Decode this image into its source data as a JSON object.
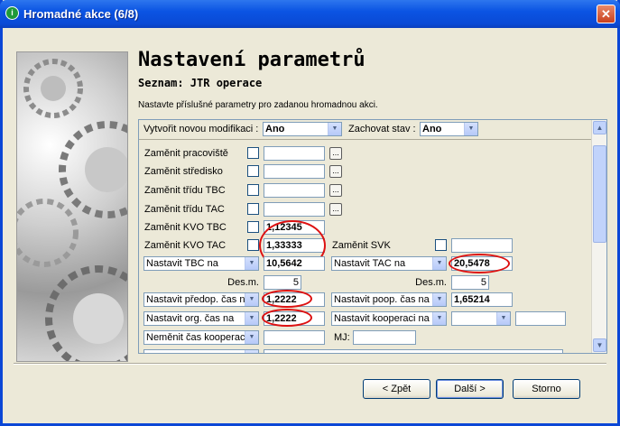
{
  "window": {
    "title": "Hromadné akce (6/8)",
    "close_glyph": "✕"
  },
  "header": {
    "title": "Nastavení parametrů",
    "subtitle": "Seznam: JTR operace",
    "description": "Nastavte příslušné parametry pro zadanou hromadnou akci."
  },
  "top_row": {
    "create_label": "Vytvořit novou modifikaci :",
    "create_value": "Ano",
    "keep_label": "Zachovat stav :",
    "keep_value": "Ano"
  },
  "rows": {
    "workplace": "Zaměnit pracoviště",
    "center": "Zaměnit středisko",
    "tbc_class": "Zaměnit třídu TBC",
    "tac_class": "Zaměnit třídu TAC",
    "kvo_tbc_label": "Zaměnit KVO TBC",
    "kvo_tbc_value": "1,12345",
    "kvo_tac_label": "Zaměnit KVO TAC",
    "kvo_tac_value": "1,33333",
    "svk_label": "Zaměnit SVK",
    "set_tbc_label": "Nastavit TBC na",
    "set_tbc_value": "10,5642",
    "set_tac_label": "Nastavit TAC na",
    "set_tac_value": "20,5478",
    "des_label_1": "Des.m.",
    "des_value_1": "5",
    "des_label_2": "Des.m.",
    "des_value_2": "5",
    "pre_op_label": "Nastavit předop. čas na",
    "pre_op_value": "1,2222",
    "post_op_label": "Nastavit poop. čas na",
    "post_op_value": "1,65214",
    "org_label": "Nastavit org. čas na",
    "org_value": "1,2222",
    "coop_label": "Nastavit kooperaci na",
    "nochange_label": "Neměnit čas kooperace",
    "mj_label": "MJ:"
  },
  "buttons": {
    "back": "< Zpět",
    "next": "Další >",
    "cancel": "Storno"
  },
  "icons": {
    "dots": "...",
    "dropdown": "▼",
    "scroll_up": "▲",
    "scroll_down": "▼",
    "app_icon": "i"
  },
  "colors": {
    "highlight_oval": "#dd1111",
    "title_bar": "#0a4ad6"
  }
}
